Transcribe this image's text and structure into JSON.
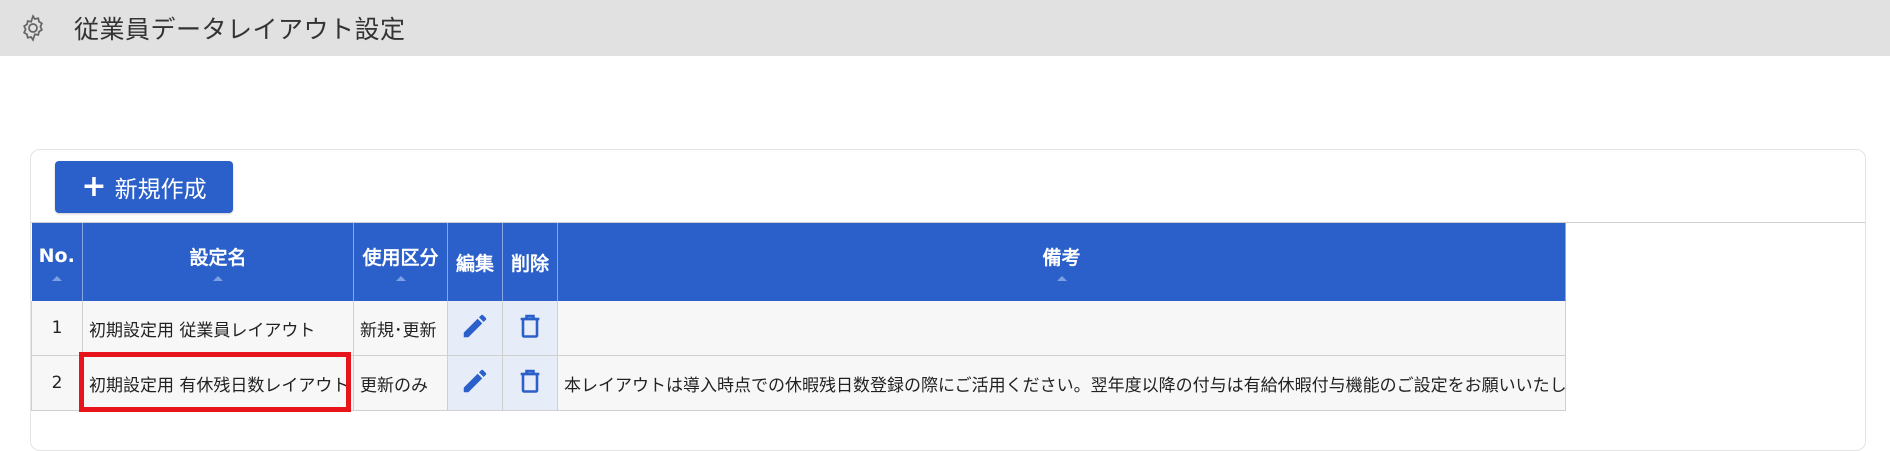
{
  "header": {
    "icon": "gear-icon",
    "title": "従業員データレイアウト設定"
  },
  "toolbar": {
    "new_button_icon": "plus-icon",
    "new_button_label": "新規作成",
    "accent_color": "#2b5fc9"
  },
  "table": {
    "columns": [
      "No.",
      "設定名",
      "使用区分",
      "編集",
      "削除",
      "備考"
    ],
    "rows": [
      {
        "no": "1",
        "name": "初期設定用 従業員レイアウト",
        "usage": "新規･更新",
        "edit_icon": "pencil-icon",
        "delete_icon": "trash-icon",
        "note": ""
      },
      {
        "no": "2",
        "name": "初期設定用 有休残日数レイアウト",
        "usage": "更新のみ",
        "edit_icon": "pencil-icon",
        "delete_icon": "trash-icon",
        "note": "本レイアウトは導入時点での休暇残日数登録の際にご活用ください。翌年度以降の付与は有給休暇付与機能のご設定をお願いいたします。"
      }
    ]
  },
  "annotation": {
    "highlight_color": "#e8141c"
  }
}
